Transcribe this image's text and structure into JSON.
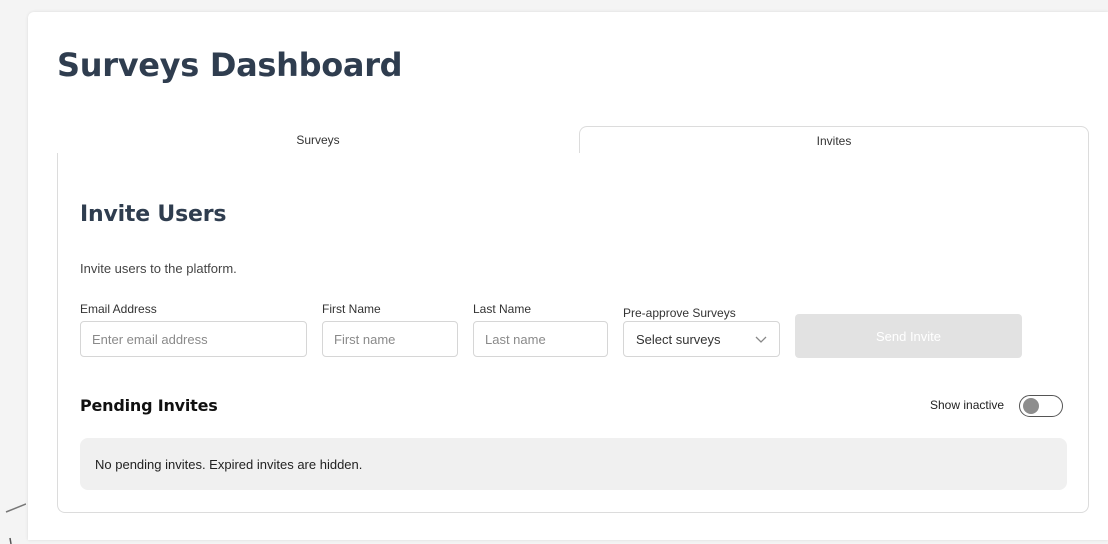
{
  "header": {
    "title": "Surveys Dashboard"
  },
  "tabs": [
    {
      "label": "Surveys",
      "active": false
    },
    {
      "label": "Invites",
      "active": true
    }
  ],
  "invite": {
    "title": "Invite Users",
    "subtitle": "Invite users to the platform.",
    "fields": {
      "email": {
        "label": "Email Address",
        "placeholder": "Enter email address",
        "value": ""
      },
      "first_name": {
        "label": "First Name",
        "placeholder": "First name",
        "value": ""
      },
      "last_name": {
        "label": "Last Name",
        "placeholder": "Last name",
        "value": ""
      },
      "surveys": {
        "label": "Pre-approve Surveys",
        "selected": "Select surveys"
      }
    },
    "send_label": "Send Invite",
    "send_disabled": true
  },
  "pending": {
    "title": "Pending Invites",
    "show_inactive_label": "Show inactive",
    "show_inactive_on": false,
    "empty_message": "No pending invites. Expired invites are hidden."
  },
  "icons": {
    "select_chevron": "chevron-down-icon"
  },
  "colors": {
    "title": "#2f3d4f",
    "button_disabled_bg": "#e2e2e2",
    "empty_box_bg": "#f0f0f0"
  }
}
